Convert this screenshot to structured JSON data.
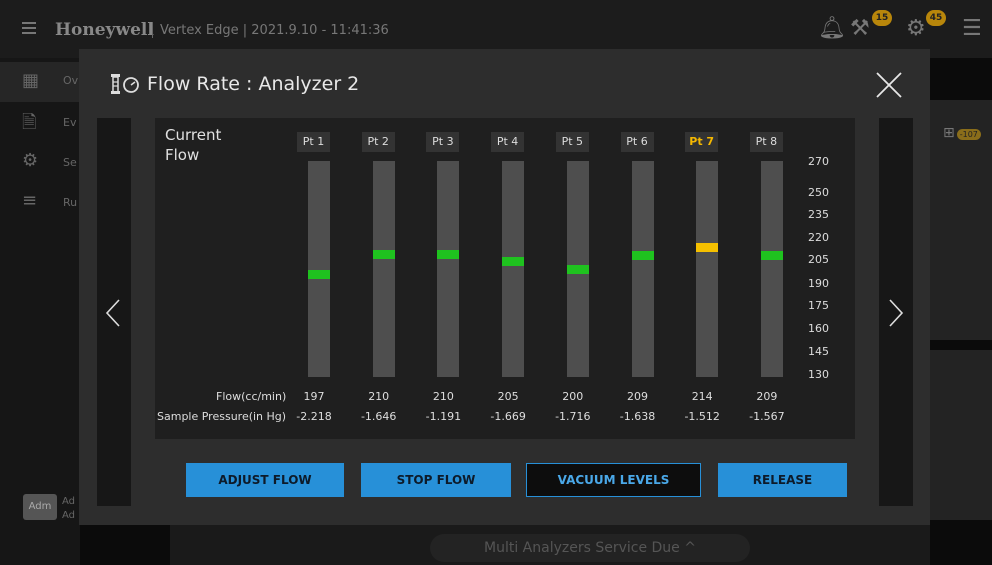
{
  "app": {
    "brand": "Honeywell",
    "subtitle": "Vertex Edge | 2021.9.10 - 11:41:36",
    "badges": {
      "tools": "15",
      "maintenance": "45"
    },
    "bg_badge": "-107",
    "nav": [
      "Ov",
      "Ev",
      "Se",
      "Ru"
    ],
    "user_badge": "Adm",
    "user_lines": [
      "Ad",
      "Ad"
    ],
    "bottom_status": "Multi Analyzers Service Due ^"
  },
  "modal": {
    "title": "Flow Rate : Analyzer 2",
    "current_flow_label": "Current\nFlow",
    "points": [
      {
        "label": "Pt 1",
        "flow": "197",
        "pressure": "-2.218",
        "active": false
      },
      {
        "label": "Pt 2",
        "flow": "210",
        "pressure": "-1.646",
        "active": false
      },
      {
        "label": "Pt 3",
        "flow": "210",
        "pressure": "-1.191",
        "active": false
      },
      {
        "label": "Pt 4",
        "flow": "205",
        "pressure": "-1.669",
        "active": false
      },
      {
        "label": "Pt 5",
        "flow": "200",
        "pressure": "-1.716",
        "active": false
      },
      {
        "label": "Pt 6",
        "flow": "209",
        "pressure": "-1.638",
        "active": false
      },
      {
        "label": "Pt 7",
        "flow": "214",
        "pressure": "-1.512",
        "active": true
      },
      {
        "label": "Pt 8",
        "flow": "209",
        "pressure": "-1.567",
        "active": false
      }
    ],
    "scale": [
      "270",
      "250",
      "235",
      "220",
      "205",
      "190",
      "175",
      "160",
      "145",
      "130"
    ],
    "flow_row_label": "Flow(cc/min)",
    "pressure_row_label": "Sample Pressure(in Hg)",
    "buttons": {
      "adjust": "ADJUST FLOW",
      "stop": "STOP FLOW",
      "vacuum": "VACUUM LEVELS",
      "release": "RELEASE"
    },
    "colors": {
      "normal_marker": "#1fc21f",
      "warning_marker": "#f5c000",
      "button": "#2790d8"
    }
  }
}
